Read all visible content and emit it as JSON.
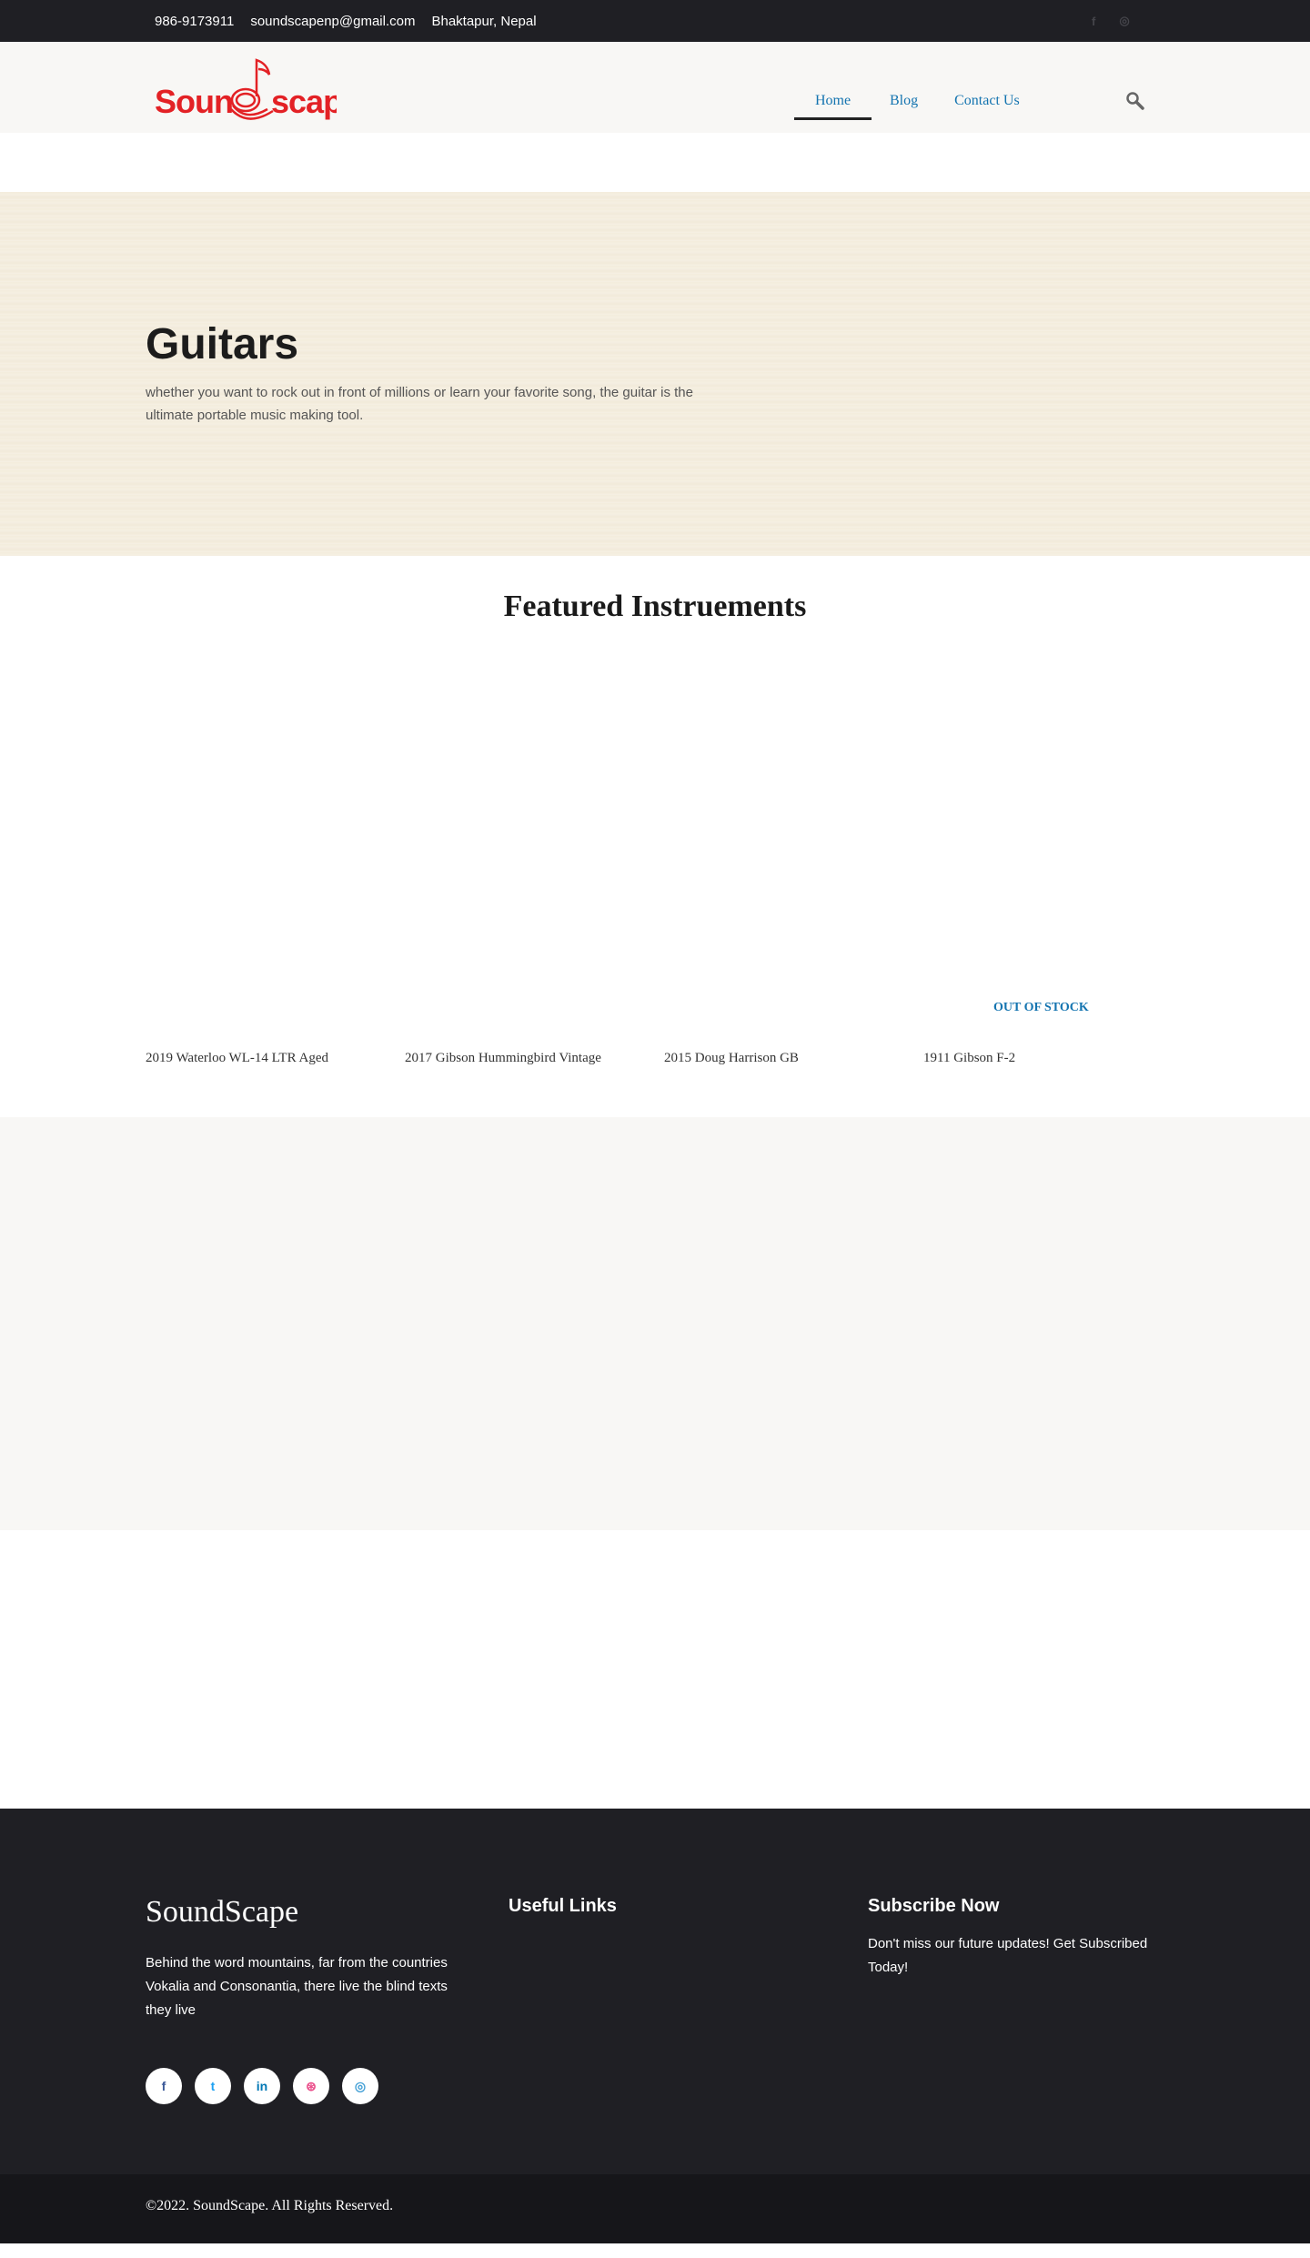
{
  "topbar": {
    "phone": "986-9173911",
    "email": "soundscapenp@gmail.com",
    "location": "Bhaktapur, Nepal",
    "socials": [
      {
        "icon": "facebook-icon",
        "glyph": "f"
      },
      {
        "icon": "instagram-icon",
        "glyph": "◎"
      }
    ]
  },
  "header": {
    "logo_text": "SoundScape",
    "nav": [
      {
        "label": "Home",
        "active": true
      },
      {
        "label": "Blog",
        "active": false
      },
      {
        "label": "Contact Us",
        "active": false
      }
    ],
    "search_icon": "search-icon"
  },
  "hero": {
    "title": "Guitars",
    "description": "whether you want to rock out in front of millions or learn your favorite song, the guitar is the ultimate portable music making tool."
  },
  "featured": {
    "title": "Featured Instruements",
    "out_of_stock": "OUT OF STOCK",
    "products": [
      {
        "name": "2019 Waterloo WL-14 LTR Aged"
      },
      {
        "name": "2017 Gibson Hummingbird Vintage"
      },
      {
        "name": "2015 Doug Harrison GB"
      },
      {
        "name": "1911 Gibson F-2"
      }
    ]
  },
  "footer": {
    "brand": "SoundScape",
    "description": "Behind the word mountains, far from the countries Vokalia and Consonantia, there live the blind texts they live",
    "useful_links_heading": "Useful Links",
    "subscribe_heading": "Subscribe Now",
    "subscribe_text": "Don't miss our future updates! Get Subscribed Today!",
    "socials": [
      {
        "icon": "facebook-icon",
        "glyph": "f",
        "color": "#3b5998"
      },
      {
        "icon": "twitter-icon",
        "glyph": "t",
        "color": "#1da1f2"
      },
      {
        "icon": "linkedin-icon",
        "glyph": "in",
        "color": "#0077b5"
      },
      {
        "icon": "dribbble-icon",
        "glyph": "⊛",
        "color": "#ea4c89"
      },
      {
        "icon": "instagram-icon",
        "glyph": "◎",
        "color": "#44a0d6"
      }
    ],
    "copyright": "©2022. SoundScape. All Rights Reserved."
  },
  "colors": {
    "brand_red": "#e32125",
    "link_blue": "#1474b0",
    "dark": "#1f1f24"
  }
}
